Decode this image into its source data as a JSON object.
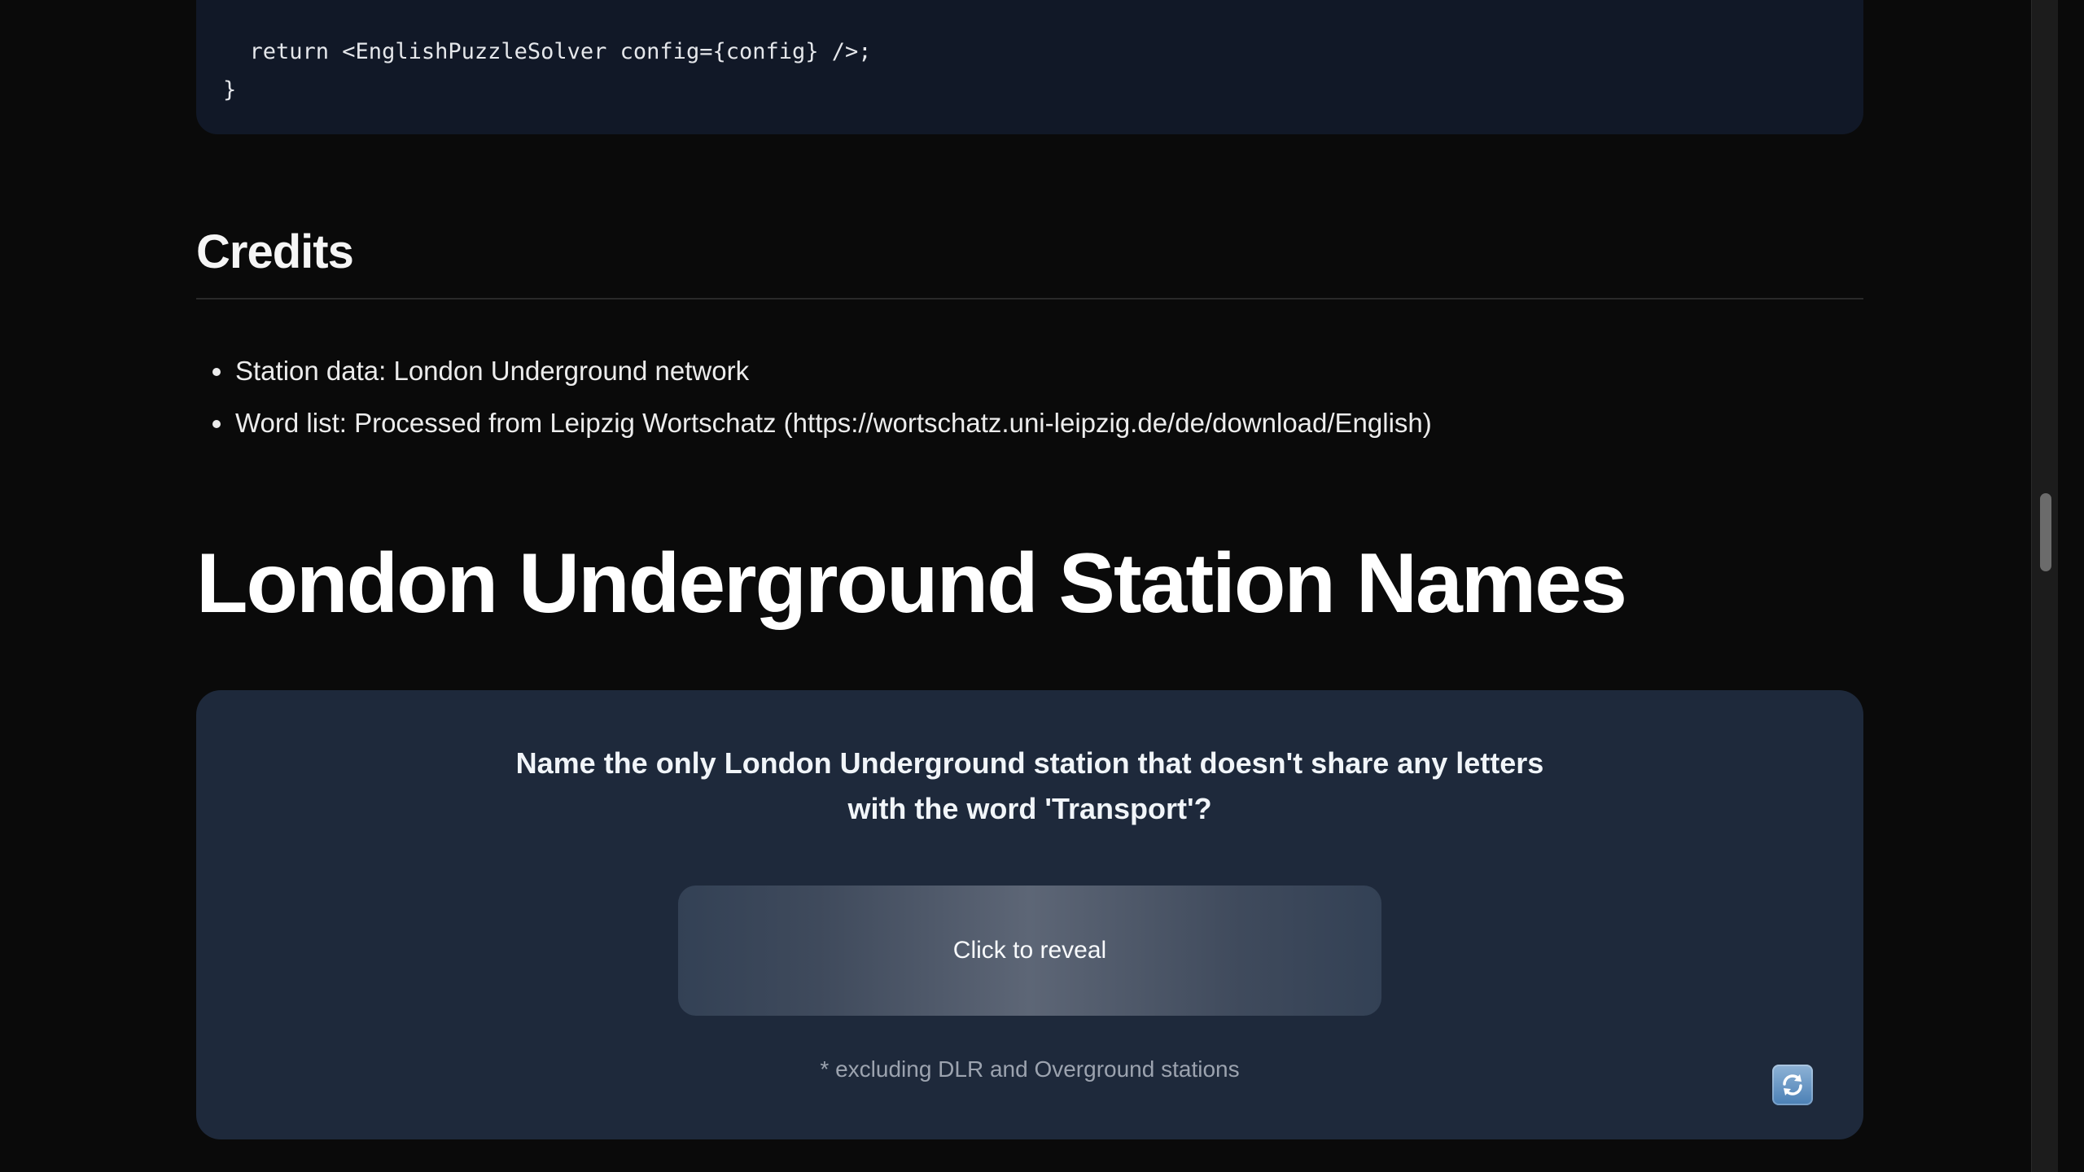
{
  "code": {
    "line1": "  return <EnglishPuzzleSolver config={config} />;",
    "line2": "}"
  },
  "credits": {
    "title": "Credits",
    "items": [
      {
        "text": "Station data: London Underground network"
      },
      {
        "text": "Word list: Processed from Leipzig Wortschatz (https://wortschatz.uni-leipzig.de/de/download/English)"
      }
    ]
  },
  "section": {
    "title": "London Underground Station Names"
  },
  "puzzle": {
    "question_line1": "Name the only London Underground station that doesn't share any letters",
    "question_line2": "with the word 'Transport'?",
    "reveal_label": "Click to reveal",
    "footnote": "* excluding DLR and Overground stations",
    "refresh_icon": "refresh-icon"
  },
  "colors": {
    "page_bg": "#0a0a0a",
    "code_bg": "#111827",
    "card_bg": "#1e293b",
    "refresh_blue": "#4a7fb5"
  }
}
